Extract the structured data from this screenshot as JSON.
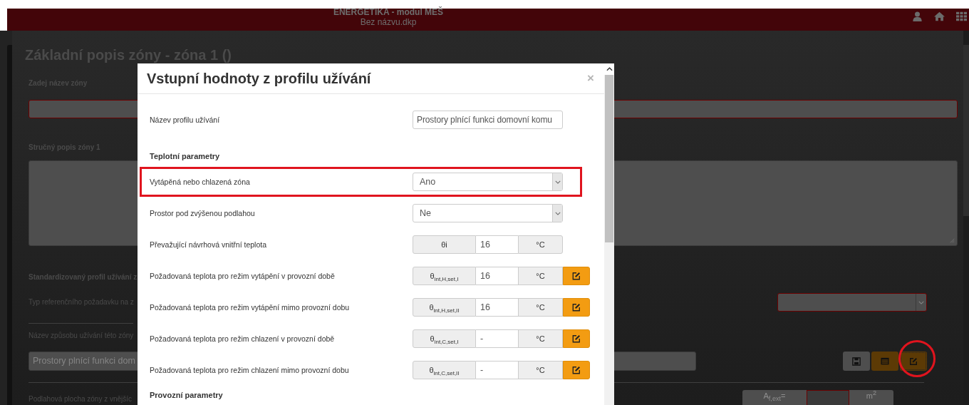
{
  "app_bar": {
    "title": "ENERGETIKA - modul MEŠ",
    "subtitle": "Bez názvu.dkp"
  },
  "page": {
    "title": "Základní popis zóny - zóna 1 ()",
    "fields": [
      {
        "kind": "text_field",
        "label": "Zadej název zóny",
        "invalid": true,
        "divider_above": false
      },
      {
        "kind": "textarea",
        "label": "Stručný popis zóny 1",
        "invalid": false,
        "divider_above": false
      },
      {
        "kind": "heading",
        "label": "Standardizovaný profil užívání z",
        "divider_above": false
      },
      {
        "kind": "select",
        "label": "Typ referenčního požadavku na z",
        "invalid": true,
        "divider_above": false
      },
      {
        "kind": "label",
        "label": "Název způsobu užívání této zóny",
        "divider_above": true
      },
      {
        "kind": "value_buttons",
        "value": "Prostory plnící funkci dom",
        "divider_above": false,
        "buttons": [
          {
            "kind": "save",
            "highlighted": false
          },
          {
            "kind": "list",
            "highlighted": false
          },
          {
            "kind": "edit",
            "highlighted": true
          }
        ]
      },
      {
        "kind": "area_field",
        "label": "Podlahová plocha zóny z vnějšíc",
        "symbol": "A$_{f,ext}$=",
        "unit": "m$^{2}$",
        "invalid": true,
        "divider_above": true
      }
    ]
  },
  "modal": {
    "title": "Vstupní hodnoty z profilu užívání",
    "close": "×",
    "rows": [
      {
        "kind": "text",
        "label": "Název profilu užívání",
        "value": "Prostory plnící funkci domovní komu",
        "highlighted": false
      },
      {
        "kind": "section",
        "label": "Teplotní parametry",
        "highlighted": false
      },
      {
        "kind": "select",
        "label": "Vytápěná nebo chlazená zóna",
        "value": "Ano",
        "highlighted": true
      },
      {
        "kind": "select",
        "label": "Prostor pod zvýšenou podlahou",
        "value": "Ne",
        "highlighted": false
      },
      {
        "kind": "addon",
        "label": "Převažující návrhová vnitřní teplota",
        "symbol": "θi",
        "value": "16",
        "unit": "°C",
        "editable": false,
        "highlighted": false
      },
      {
        "kind": "addon",
        "label": "Požadovaná teplota pro režim vytápění v provozní době",
        "symbol": "θ$_{int,H,set,I}$",
        "value": "16",
        "unit": "°C",
        "editable": true,
        "highlighted": false
      },
      {
        "kind": "addon",
        "label": "Požadovaná teplota pro režim vytápění mimo provozní dobu",
        "symbol": "θ$_{int,H,set,II}$",
        "value": "16",
        "unit": "°C",
        "editable": true,
        "highlighted": false
      },
      {
        "kind": "addon",
        "label": "Požadovaná teplota pro režim chlazení v provozní době",
        "symbol": "θ$_{int,C,set,I}$",
        "value": "-",
        "unit": "°C",
        "editable": true,
        "highlighted": false
      },
      {
        "kind": "addon",
        "label": "Požadovaná teplota pro režim chlazení mimo provozní dobu",
        "symbol": "θ$_{int,C,set,II}$",
        "value": "-",
        "unit": "°C",
        "editable": true,
        "highlighted": false
      },
      {
        "kind": "section",
        "label": "Provozní parametry",
        "highlighted": false
      }
    ]
  }
}
